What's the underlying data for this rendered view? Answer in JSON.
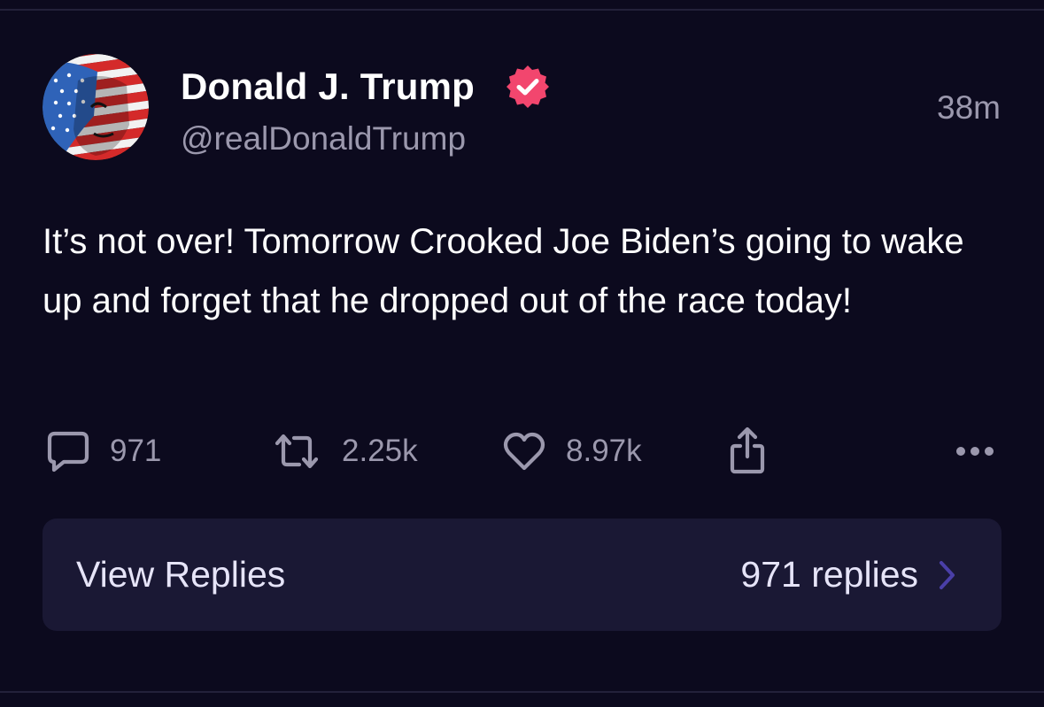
{
  "post": {
    "display_name": "Donald J. Trump",
    "handle": "@realDonaldTrump",
    "timestamp": "38m",
    "text": "It’s not over! Tomorrow Crooked Joe Biden’s going to wake up and forget that he dropped out of the race today!",
    "verified": true
  },
  "actions": {
    "replies": "971",
    "reposts": "2.25k",
    "likes": "8.97k"
  },
  "replies_bar": {
    "label": "View Replies",
    "count": "971 replies"
  },
  "colors": {
    "background": "#0c0a1e",
    "verified_badge": "#f2466e",
    "muted_text": "#9b98ad",
    "replies_bar": "#1a1834",
    "chevron": "#4a3fa8"
  },
  "icons": [
    "comment-icon",
    "repost-icon",
    "heart-icon",
    "share-icon",
    "more-icon",
    "verified-badge-icon",
    "chevron-right-icon"
  ]
}
